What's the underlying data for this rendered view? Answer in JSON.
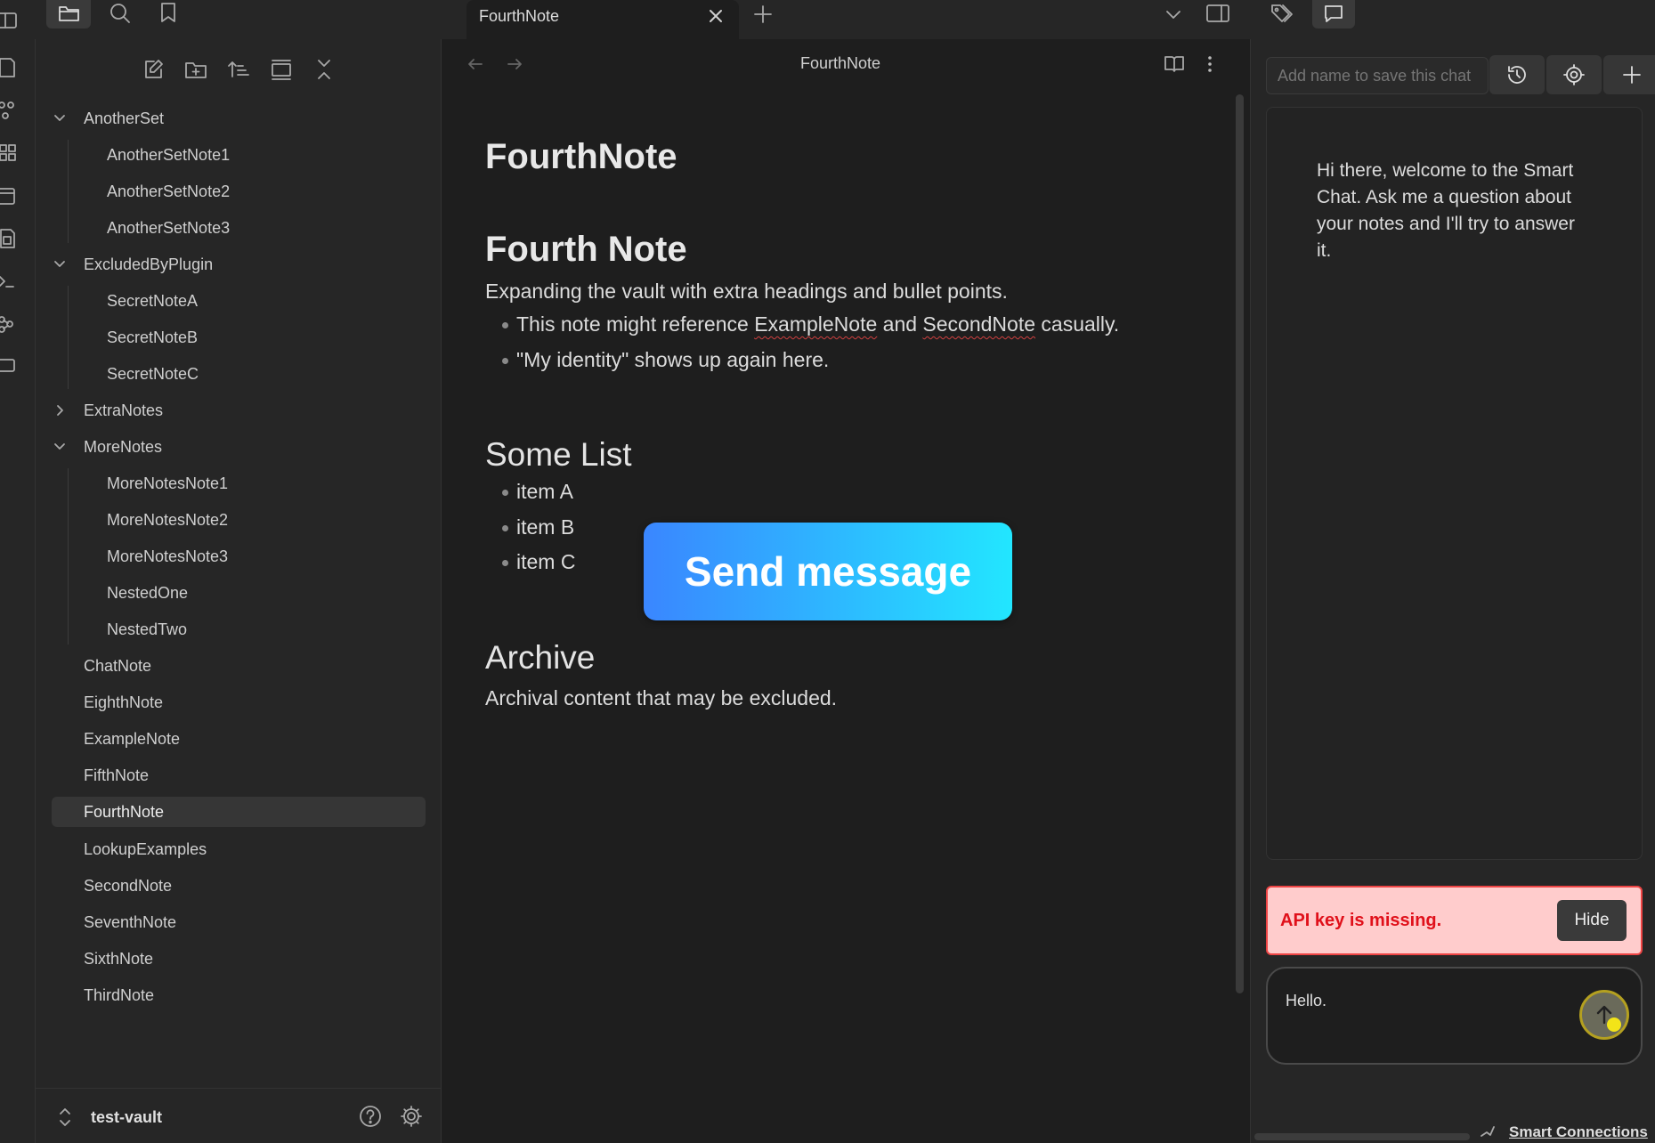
{
  "tabs": {
    "active_title": "FourthNote"
  },
  "editor": {
    "header_title": "FourthNote",
    "inline_title": "FourthNote",
    "h_fourth": "Fourth Note",
    "p1": "Expanding the vault with extra headings and bullet points.",
    "b1_pre": "This note might reference ",
    "b1_link1": "ExampleNote",
    "b1_mid": " and ",
    "b1_link2": "SecondNote",
    "b1_post": " casually.",
    "b2": "\"My identity\" shows up again here.",
    "h_list": "Some List",
    "list": [
      "item A",
      "item B",
      "item C"
    ],
    "h_archive": "Archive",
    "p_archive": "Archival content that may be excluded.",
    "overlay_button": "Send message"
  },
  "sidebar": {
    "tree": [
      {
        "label": "AnotherSet",
        "type": "folder",
        "open": true,
        "depth": 0
      },
      {
        "label": "AnotherSetNote1",
        "type": "file",
        "depth": 1
      },
      {
        "label": "AnotherSetNote2",
        "type": "file",
        "depth": 1
      },
      {
        "label": "AnotherSetNote3",
        "type": "file",
        "depth": 1
      },
      {
        "label": "ExcludedByPlugin",
        "type": "folder",
        "open": true,
        "depth": 0
      },
      {
        "label": "SecretNoteA",
        "type": "file",
        "depth": 1
      },
      {
        "label": "SecretNoteB",
        "type": "file",
        "depth": 1
      },
      {
        "label": "SecretNoteC",
        "type": "file",
        "depth": 1
      },
      {
        "label": "ExtraNotes",
        "type": "folder",
        "open": false,
        "depth": 0
      },
      {
        "label": "MoreNotes",
        "type": "folder",
        "open": true,
        "depth": 0
      },
      {
        "label": "MoreNotesNote1",
        "type": "file",
        "depth": 1
      },
      {
        "label": "MoreNotesNote2",
        "type": "file",
        "depth": 1
      },
      {
        "label": "MoreNotesNote3",
        "type": "file",
        "depth": 1
      },
      {
        "label": "NestedOne",
        "type": "file",
        "depth": 1
      },
      {
        "label": "NestedTwo",
        "type": "file",
        "depth": 1
      },
      {
        "label": "ChatNote",
        "type": "file",
        "depth": 0
      },
      {
        "label": "EighthNote",
        "type": "file",
        "depth": 0
      },
      {
        "label": "ExampleNote",
        "type": "file",
        "depth": 0
      },
      {
        "label": "FifthNote",
        "type": "file",
        "depth": 0
      },
      {
        "label": "FourthNote",
        "type": "file",
        "depth": 0,
        "selected": true
      },
      {
        "label": "LookupExamples",
        "type": "file",
        "depth": 0
      },
      {
        "label": "SecondNote",
        "type": "file",
        "depth": 0
      },
      {
        "label": "SeventhNote",
        "type": "file",
        "depth": 0
      },
      {
        "label": "SixthNote",
        "type": "file",
        "depth": 0
      },
      {
        "label": "ThirdNote",
        "type": "file",
        "depth": 0
      }
    ],
    "vault_name": "test-vault"
  },
  "chat": {
    "name_placeholder": "Add name to save this chat",
    "welcome": "Hi there, welcome to the Smart Chat. Ask me a question about your notes and I'll try to answer it.",
    "error": "API key is missing.",
    "hide_label": "Hide",
    "input_value": "Hello.",
    "footer_label": "Smart Connections"
  },
  "colors": {
    "accent_from": "#3a86ff",
    "accent_to": "#22e6ff",
    "error_bg": "#ffcccc",
    "error_text": "#e0101a"
  }
}
